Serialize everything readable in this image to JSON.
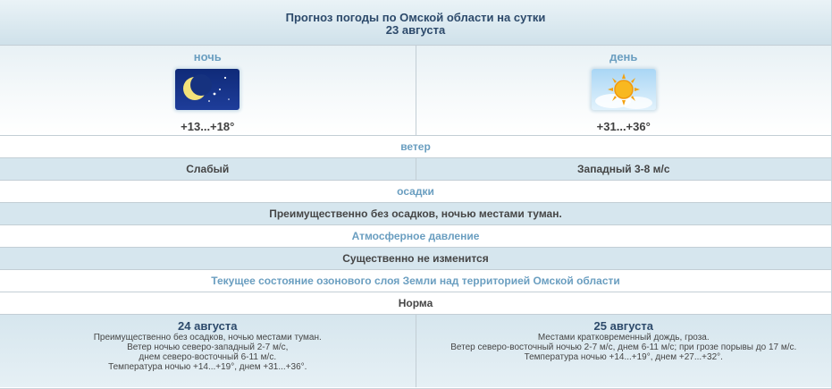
{
  "header": {
    "title": "Прогноз погоды по Омской области на сутки",
    "date": "23 августа"
  },
  "night": {
    "label": "ночь",
    "icon": "moon-stars-icon",
    "temp": "+13...+18°"
  },
  "day": {
    "label": "день",
    "icon": "sun-cloud-icon",
    "temp": "+31...+36°"
  },
  "wind": {
    "heading": "ветер",
    "strength": "Слабый",
    "direction": "Западный 3-8 м/с"
  },
  "precipitation": {
    "heading": "осадки",
    "value": "Преимущественно без осадков, ночью местами туман."
  },
  "pressure": {
    "heading": "Атмосферное давление",
    "value": "Существенно не изменится"
  },
  "ozone": {
    "heading": "Текущее состояние озонового слоя Земли над территорией Омской области",
    "value": "Норма"
  },
  "forecast": [
    {
      "date": "24 августа",
      "lines": [
        "Преимущественно без осадков, ночью местами туман.",
        "Ветер ночью северо-западный 2-7 м/с,",
        "днем северо-восточный 6-11 м/с.",
        "Температура ночью +14...+19°, днем +31...+36°."
      ]
    },
    {
      "date": "25 августа",
      "lines": [
        "Местами кратковременный дождь, гроза.",
        "Ветер северо-восточный ночью 2-7 м/с, днем 6-11 м/с; при грозе порывы до 17 м/с.",
        "Температура ночью +14...+19°, днем +27...+32°."
      ]
    }
  ],
  "colors": {
    "title": "#2d4a6b",
    "heading": "#6a9ec0",
    "value_bg": "#d6e6ee",
    "text": "#454545"
  }
}
